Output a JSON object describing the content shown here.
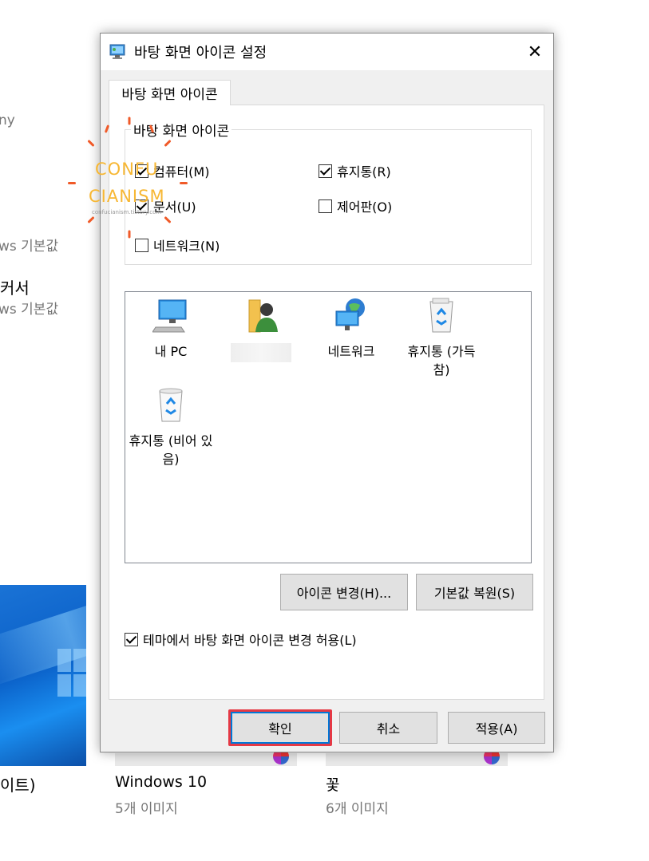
{
  "background": {
    "fragments": [
      "ny",
      "ws 기본값",
      "커서",
      "ws 기본값",
      "이트)"
    ],
    "themes": [
      {
        "name": "Windows 10",
        "count": "5개 이미지"
      },
      {
        "name": "꽃",
        "count": "6개 이미지"
      }
    ]
  },
  "watermark": {
    "line1": "CONFU",
    "line2": "CIANISM",
    "url": "confucianism.tistory.com"
  },
  "dialog": {
    "title": "바탕 화면 아이콘 설정",
    "close_glyph": "✕",
    "tab_label": "바탕 화면 아이콘",
    "group_title": "바탕 화면 아이콘",
    "checkboxes": [
      {
        "label": "컴퓨터(M)",
        "checked": true
      },
      {
        "label": "휴지통(R)",
        "checked": true
      },
      {
        "label": "문서(U)",
        "checked": true
      },
      {
        "label": "제어판(O)",
        "checked": false
      },
      {
        "label": "네트워크(N)",
        "checked": false
      }
    ],
    "icons": [
      {
        "label": "내 PC",
        "icon": "computer-icon"
      },
      {
        "label": "",
        "icon": "user-folder-icon"
      },
      {
        "label": "네트워크",
        "icon": "network-icon"
      },
      {
        "label": "휴지통 (가득 참)",
        "icon": "recycle-bin-full-icon"
      },
      {
        "label": "휴지통 (비어 있음)",
        "icon": "recycle-bin-empty-icon"
      }
    ],
    "change_icon_button": "아이콘 변경(H)...",
    "restore_default_button": "기본값 복원(S)",
    "allow_theme_label": "테마에서 바탕 화면 아이콘 변경 허용(L)",
    "allow_theme_checked": true,
    "ok_button": "확인",
    "cancel_button": "취소",
    "apply_button": "적용(A)"
  },
  "colors": {
    "highlight": "#e53945",
    "accent": "#0078d7",
    "watermark": "#f7b733"
  }
}
